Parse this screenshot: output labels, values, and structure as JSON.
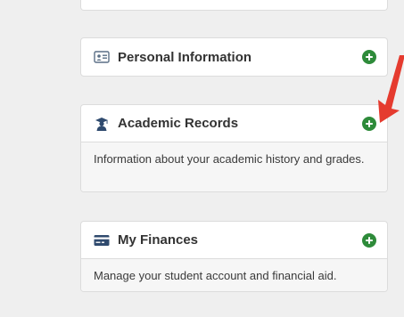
{
  "cards": [
    {
      "title": "Personal Information",
      "icon": "id-card-icon",
      "action_icon": "plus-circle-icon"
    },
    {
      "title": "Academic Records",
      "icon": "graduate-icon",
      "action_icon": "plus-circle-icon",
      "description": "Information about your academic history and grades."
    },
    {
      "title": "My Finances",
      "icon": "credit-card-icon",
      "action_icon": "plus-circle-icon",
      "description": "Manage your student account and financial aid."
    }
  ],
  "annotation": {
    "icon": "red-arrow-icon",
    "color": "#e53b2f"
  },
  "colors": {
    "accent_green": "#2e8b3a",
    "icon_navy": "#2f4a6e",
    "background": "#efefef"
  }
}
